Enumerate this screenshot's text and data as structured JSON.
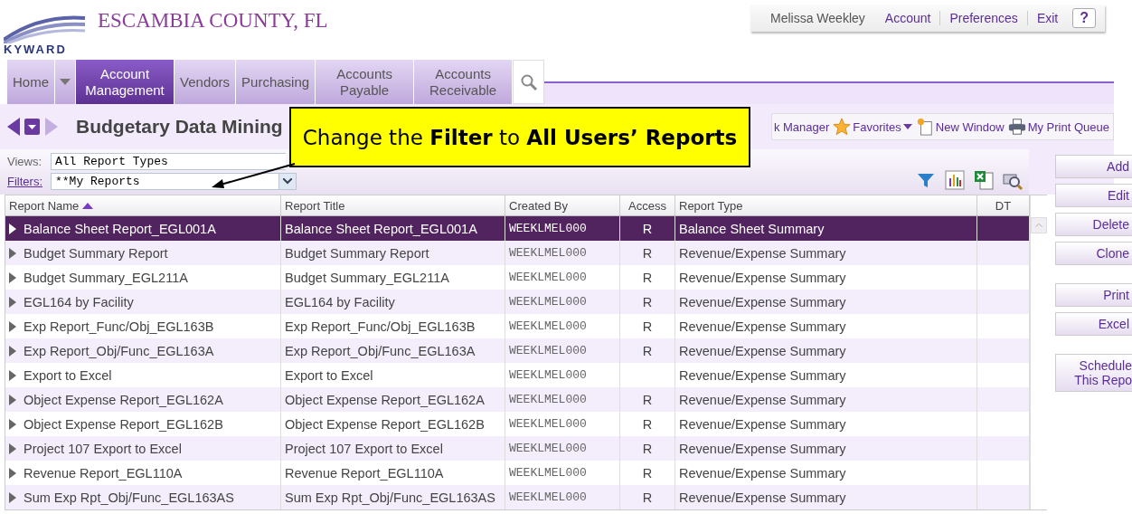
{
  "header": {
    "logo_text": "KYWARD",
    "district": "ESCAMBIA COUNTY, FL",
    "user": "Melissa Weekley",
    "links": [
      "Account",
      "Preferences",
      "Exit"
    ],
    "help": "?"
  },
  "nav": {
    "tabs": [
      {
        "label": "Home",
        "kind": "split",
        "selected": false
      },
      {
        "label": "Account Management",
        "kind": "tab",
        "selected": true
      },
      {
        "label": "Vendors",
        "kind": "tab",
        "selected": false
      },
      {
        "label": "Purchasing",
        "kind": "tab",
        "selected": false
      },
      {
        "label": "Accounts Payable",
        "kind": "tab",
        "selected": false
      },
      {
        "label": "Accounts Receivable",
        "kind": "tab",
        "selected": false
      }
    ]
  },
  "page_title": "Budgetary Data Mining",
  "toolbar": [
    {
      "kind": "text",
      "label": "k Manager"
    },
    {
      "kind": "favorites",
      "label": "Favorites"
    },
    {
      "kind": "new-window",
      "label": "New Window"
    },
    {
      "kind": "print",
      "label": "My Print Queue"
    }
  ],
  "views": {
    "label": "Views:",
    "value": "All Report Types"
  },
  "filters": {
    "label": "Filters:",
    "value": "**My Reports"
  },
  "table": {
    "columns": [
      "Report Name",
      "Report Title",
      "Created By",
      "Access",
      "Report Type",
      "DT"
    ],
    "rows": [
      {
        "name": "Balance Sheet Report_EGL001A",
        "title": "Balance Sheet Report_EGL001A",
        "created_by": "WEEKLMEL000",
        "access": "R",
        "type": "Balance Sheet Summary",
        "selected": true
      },
      {
        "name": "Budget Summary Report",
        "title": "Budget Summary Report",
        "created_by": "WEEKLMEL000",
        "access": "R",
        "type": "Revenue/Expense Summary",
        "selected": false
      },
      {
        "name": "Budget Summary_EGL211A",
        "title": "Budget Summary_EGL211A",
        "created_by": "WEEKLMEL000",
        "access": "R",
        "type": "Revenue/Expense Summary",
        "selected": false
      },
      {
        "name": "EGL164 by Facility",
        "title": "EGL164 by Facility",
        "created_by": "WEEKLMEL000",
        "access": "R",
        "type": "Revenue/Expense Summary",
        "selected": false
      },
      {
        "name": "Exp Report_Func/Obj_EGL163B",
        "title": "Exp Report_Func/Obj_EGL163B",
        "created_by": "WEEKLMEL000",
        "access": "R",
        "type": "Revenue/Expense Summary",
        "selected": false
      },
      {
        "name": "Exp Report_Obj/Func_EGL163A",
        "title": "Exp Report_Obj/Func_EGL163A",
        "created_by": "WEEKLMEL000",
        "access": "R",
        "type": "Revenue/Expense Summary",
        "selected": false
      },
      {
        "name": "Export to Excel",
        "title": "Export to Excel",
        "created_by": "WEEKLMEL000",
        "type": "Revenue/Expense Summary",
        "selected": false
      },
      {
        "name": "Object Expense Report_EGL162A",
        "title": "Object Expense Report_EGL162A",
        "created_by": "WEEKLMEL000",
        "access": "R",
        "type": "Revenue/Expense Summary",
        "selected": false
      },
      {
        "name": "Object Expense Report_EGL162B",
        "title": "Object Expense Report_EGL162B",
        "created_by": "WEEKLMEL000",
        "access": "R",
        "type": "Revenue/Expense Summary",
        "selected": false
      },
      {
        "name": "Project 107 Export to Excel",
        "title": "Project 107 Export to Excel",
        "created_by": "WEEKLMEL000",
        "access": "R",
        "type": "Revenue/Expense Summary",
        "selected": false
      },
      {
        "name": "Revenue Report_EGL110A",
        "title": "Revenue Report_EGL110A",
        "created_by": "WEEKLMEL000",
        "access": "R",
        "type": "Revenue/Expense Summary",
        "selected": false
      },
      {
        "name": "Sum Exp Rpt_Obj/Func_EGL163AS",
        "title": "Sum Exp Rpt_Obj/Func_EGL163AS",
        "created_by": "WEEKLMEL000",
        "access": "R",
        "type": "Revenue/Expense Summary",
        "selected": false
      }
    ]
  },
  "action_groups": [
    [
      "Add",
      "Edit",
      "Delete",
      "Clone"
    ],
    [
      "Print",
      "Excel"
    ],
    [
      "Schedule This Repo"
    ]
  ],
  "callout": "Change the **Filter** to **All Users’ Reports**"
}
